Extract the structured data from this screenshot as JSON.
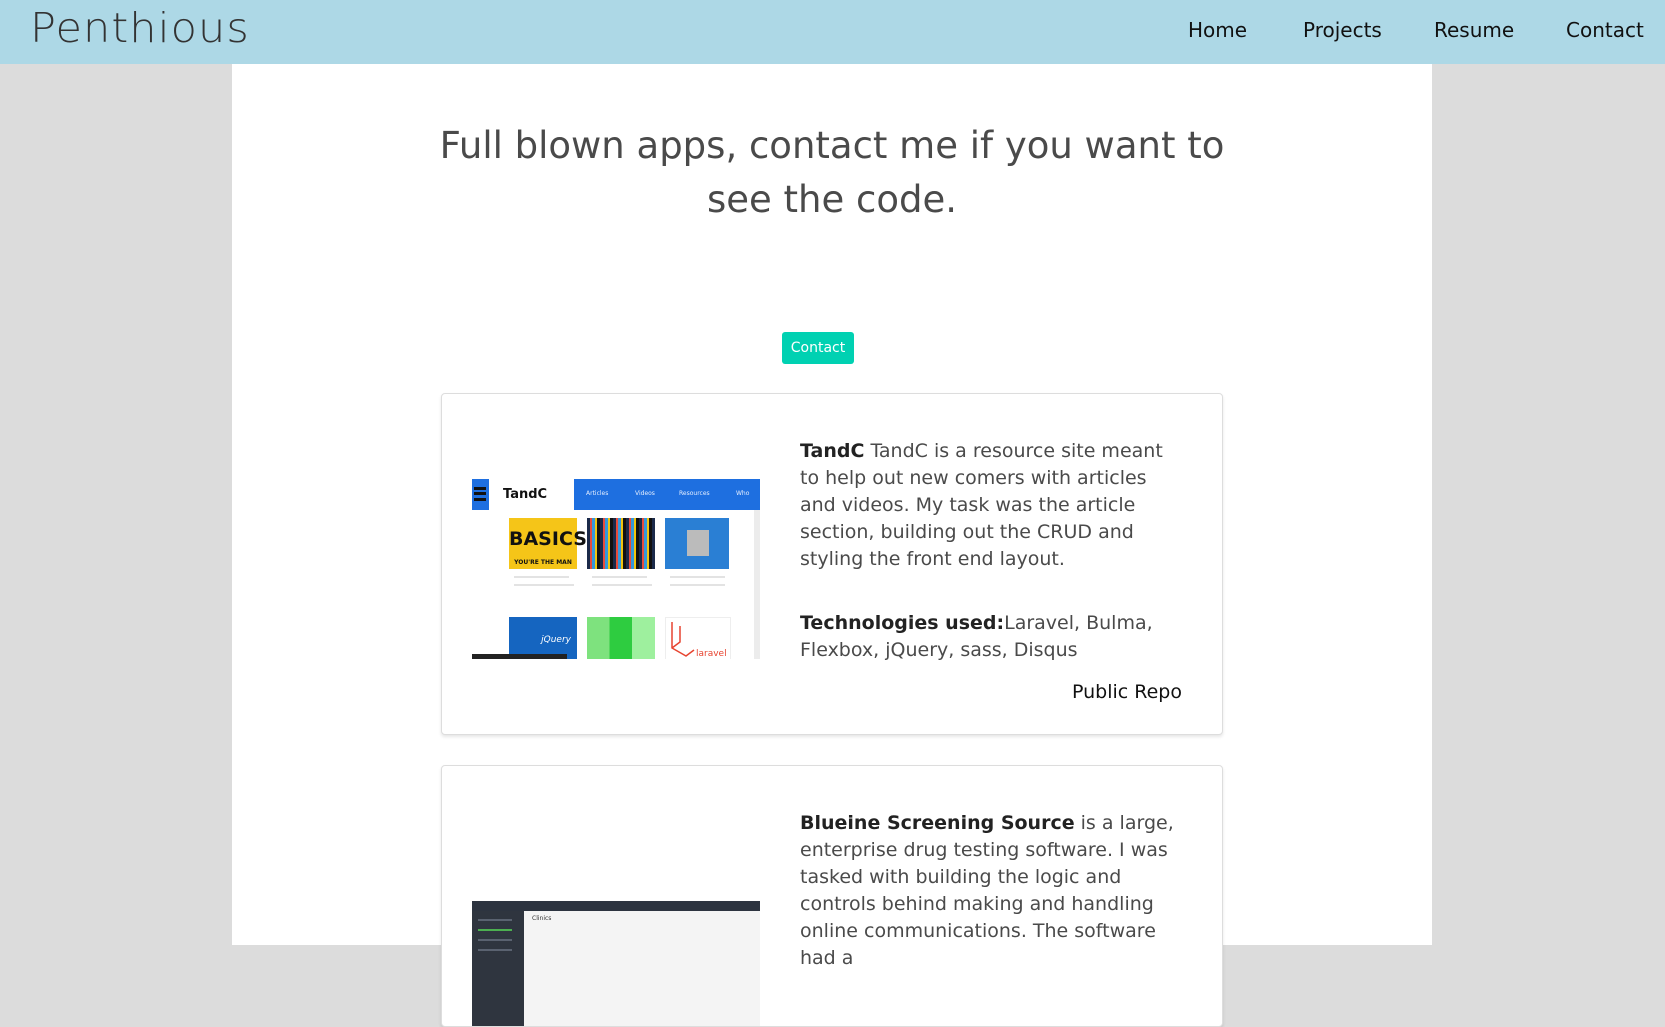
{
  "navbar": {
    "brand": "Penthious",
    "links": [
      "Home",
      "Projects",
      "Resume",
      "Contact"
    ]
  },
  "main": {
    "headline": "Full blown apps, contact me if you want to see the code.",
    "contact_button": "Contact"
  },
  "projects": [
    {
      "name": "TandC",
      "description": " TandC is a resource site meant to help out new comers with articles and videos. My task was the article section, building out the CRUD and styling the front end layout.",
      "tech_label": "Technologies used:",
      "technologies": "Laravel, Bulma, Flexbox, jQuery, sass, Disqus",
      "repo_link": "Public Repo",
      "thumbnail": {
        "logo": "TandC",
        "nav": [
          "Articles",
          "Videos",
          "Resources",
          "Who"
        ],
        "tiles": [
          "BASICS",
          "YOU'RE THE MAN",
          "jQuery",
          "laravel"
        ]
      }
    },
    {
      "name": "Blueine Screening Source",
      "description": " is a large, enterprise drug testing software. I was tasked with building the logic and controls behind making and handling online communications. The software had a",
      "thumbnail": {
        "title": "Clinics"
      }
    }
  ],
  "colors": {
    "navbar_bg": "#add8e6",
    "page_bg": "#dcdcdc",
    "button_bg": "#00d1b2"
  }
}
